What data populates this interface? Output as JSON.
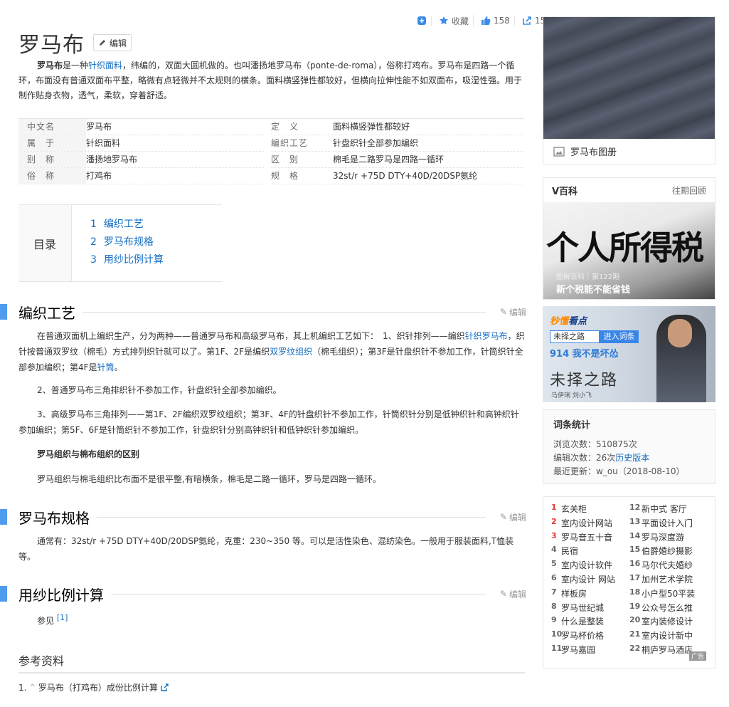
{
  "toolbar": {
    "collect_label": "收藏",
    "like_count": "158",
    "share_count": "15"
  },
  "title": "罗马布",
  "edit_label": "编辑",
  "intro": {
    "term": "罗马布",
    "t1": "是一种",
    "link1": "针织面料",
    "t2": "，纬编的，双面大圆机做的。也叫潘扬地罗马布（ponte-de-roma），俗称打鸡布。罗马布是四路一个循环，布面没有普通双面布平整，略微有点轻微并不太规则的横条。面料横竖弹性都较好，但横向拉伸性能不如双面布，吸湿性强。用于制作贴身衣物，透气，柔软，穿着舒适。"
  },
  "basic_info": [
    {
      "k1": "中文名",
      "v1": "罗马布",
      "v1_link": true,
      "k2": "定　义",
      "v2": "面料横竖弹性都较好"
    },
    {
      "k1": "属　于",
      "v1": "针织面料",
      "v1_link": true,
      "k2": "编织工艺",
      "v2": "针盘织针全部参加编织"
    },
    {
      "k1": "别　称",
      "v1": "潘扬地罗马布",
      "v1_link": false,
      "k2": "区　别",
      "v2": "棉毛是二路罗马是四路一循环"
    },
    {
      "k1": "俗　称",
      "v1": "打鸡布",
      "v1_link": false,
      "k2": "规　格",
      "v2": "32st/r +75D DTY+40D/20DSP氨纶"
    }
  ],
  "catalog": {
    "title": "目录",
    "items": [
      {
        "n": "1",
        "label": "编织工艺"
      },
      {
        "n": "2",
        "label": "罗马布规格"
      },
      {
        "n": "3",
        "label": "用纱比例计算"
      }
    ]
  },
  "sections": {
    "s1": {
      "title": "编织工艺",
      "p1a": "在普通双面机上编织生产，分为两种——普通罗马布和高级罗马布，其上机编织工艺如下：　1、织针排列——编织",
      "p1_link1": "针织罗马布",
      "p1b": "，织针按普通双罗纹（棉毛）方式排列织针就可以了。第1F、2F是编织",
      "p1_link2": "双罗纹组织",
      "p1c": "（棉毛组织）；第3F是针盘织针不参加工作，针筒织针全部参加编织；第4F是",
      "p1_link3": "针筒",
      "p1d": "。",
      "p2": "2、普通罗马布三角排织针不参加工作，针盘织针全部参加编织。",
      "p3": "3、高级罗马布三角排列——第1F、2F编织双罗纹组织；第3F、4F的针盘织针不参加工作，针筒织针分别是低钟织针和高钟织针参加编织；第5F、6F是针筒织针不参加工作，针盘织针分别高钟织针和低钟织针参加编织。",
      "p4": "罗马组织与棉布组织的区别",
      "p5": "罗马组织与棉毛组织比布面不是很平整,有暗横条，棉毛是二路一循环，罗马是四路一循环。"
    },
    "s2": {
      "title": "罗马布规格",
      "p1": "通常有：32st/r +75D DTY+40D/20DSP氨纶，克重：230~350 等。可以是活性染色、混纺染色。一般用于服装面料,T恤装等。"
    },
    "s3": {
      "title": "用纱比例计算",
      "p1": "参见",
      "sup": "[1]"
    }
  },
  "references": {
    "title": "参考资料",
    "items": [
      {
        "n": "1.",
        "label": "罗马布（打鸡布）成份比例计算"
      }
    ]
  },
  "sidebar": {
    "album_caption": "罗马布图册",
    "vbaike": {
      "title": "V百科",
      "more": "往期回顾",
      "headline": "个人所得税",
      "meta": "图解百科｜第122期",
      "subtitle": "新个税能不能省钱"
    },
    "promo": {
      "brand1": "秒懂",
      "brand2": "看点",
      "query": "未择之路",
      "go": "进入词条",
      "hit": "914 我不是坏怂",
      "callig": "未择之路",
      "cast": "马伊琍 刘小飞"
    },
    "stats": {
      "title": "词条统计",
      "views": "浏览次数：510875次",
      "edits_prefix": "编辑次数：26次",
      "edits_link": "历史版本",
      "updated": "最近更新：w_ou（2018-08-10）"
    },
    "hot_left": [
      {
        "n": "1",
        "label": "玄关柜"
      },
      {
        "n": "2",
        "label": "室内设计网站"
      },
      {
        "n": "3",
        "label": "罗马音五十音"
      },
      {
        "n": "4",
        "label": "民宿"
      },
      {
        "n": "5",
        "label": "室内设计软件"
      },
      {
        "n": "6",
        "label": "室内设计 网站"
      },
      {
        "n": "7",
        "label": "样板房"
      },
      {
        "n": "8",
        "label": "罗马世纪城"
      },
      {
        "n": "9",
        "label": "什么是整装"
      },
      {
        "n": "10",
        "label": "罗马杯价格"
      },
      {
        "n": "11",
        "label": "罗马嘉园"
      }
    ],
    "hot_right": [
      {
        "n": "12",
        "label": "新中式 客厅"
      },
      {
        "n": "13",
        "label": "平面设计入门"
      },
      {
        "n": "14",
        "label": "罗马深度游"
      },
      {
        "n": "15",
        "label": "伯爵婚纱摄影"
      },
      {
        "n": "16",
        "label": "马尔代夫婚纱"
      },
      {
        "n": "17",
        "label": "加州艺术学院"
      },
      {
        "n": "18",
        "label": "小户型50平装"
      },
      {
        "n": "19",
        "label": "公众号怎么推"
      },
      {
        "n": "20",
        "label": "室内装修设计"
      },
      {
        "n": "21",
        "label": "室内设计新中"
      },
      {
        "n": "22",
        "label": "桐庐罗马酒店"
      }
    ],
    "ad_label": "广告"
  }
}
